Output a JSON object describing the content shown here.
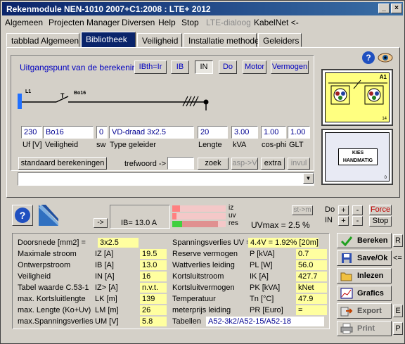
{
  "title": "Rekenmodule NEN-1010 2007+C1:2008 : LTE+ 2012",
  "menu": [
    "Algemeen",
    "Projecten Manager",
    "Diversen",
    "Help",
    "Stop",
    "LTE-dialoog",
    "KabelNet <-"
  ],
  "tabs": [
    "tabblad Algemeen",
    "Bibliotheek",
    "Veiligheid",
    "Installatie methode",
    "Geleiders"
  ],
  "basis": {
    "label": "Uitgangspunt van de berekening",
    "buttons": [
      "IBth=Ir",
      "IB",
      "IN",
      "Do",
      "Motor",
      "Vermogen"
    ]
  },
  "diagram": {
    "l1": "L1",
    "t": "T",
    "bo16": "Bo16"
  },
  "fields": {
    "uf": "230",
    "veiligheid": "Bo16",
    "sw": "0",
    "geleider": "VD-draad 3x2.5",
    "lengte": "20",
    "kva": "3.00",
    "cosphi": "1.00",
    "glt": "1.00"
  },
  "field_labels": [
    "Uf [V]",
    "Veiligheid",
    "sw",
    "Type geleider",
    "Lengte",
    "kVA",
    "cos-phi",
    "GLT"
  ],
  "search": {
    "standaard": "standaard berekeningen",
    "trefwoord": "trefwoord ->",
    "zoek": "zoek",
    "asp": "asp->V",
    "extra": "extra",
    "invul": "invul"
  },
  "thumb1": {
    "label": "A1",
    "corner": "14"
  },
  "thumb2": {
    "line1": "KIES",
    "line2": "HANDMATIG",
    "corner": "0"
  },
  "status": {
    "arrow": "->",
    "ib": "IB=  13.0 A",
    "legend_iz": "iz",
    "legend_uv": "uv",
    "legend_res": "res",
    "uvmax": "UVmax = 2.5 %",
    "stm": "st->m",
    "do": "Do",
    "in": "IN",
    "plus": "+",
    "minus": "-",
    "force": "Force",
    "stop": "Stop"
  },
  "results_left": [
    {
      "label": "Doorsnede [mm2] =",
      "sym": "",
      "val": "3x2.5"
    },
    {
      "label": "Maximale stroom",
      "sym": "IZ  [A]",
      "val": "19.5"
    },
    {
      "label": "Ontwerpstroom",
      "sym": "IB  [A]",
      "val": "13.0"
    },
    {
      "label": "Veiligheid",
      "sym": "IN  [A]",
      "val": "16"
    },
    {
      "label": "Tabel waarde C.53-1",
      "sym": "IZ> [A]",
      "val": "n.v.t."
    },
    {
      "label": "max. Kortsluitlengte",
      "sym": "LK  [m]",
      "val": "139"
    },
    {
      "label": "max. Lengte (Ko+Uv)",
      "sym": "LM  [m]",
      "val": "26"
    },
    {
      "label": "max.Spanningsverlies",
      "sym": "UM [V]",
      "val": "5.8"
    }
  ],
  "results_right": [
    {
      "label": "Spanningsverlies UV =",
      "sym": "",
      "val": "4.4V = 1.92% [20m]"
    },
    {
      "label": "Reserve vermogen",
      "sym": "P   [kVA]",
      "val": "0.7"
    },
    {
      "label": "Wattverlies leiding",
      "sym": "PL  [W]",
      "val": "56.0"
    },
    {
      "label": "Kortsluitstroom",
      "sym": "IK  [A]",
      "val": "427.7"
    },
    {
      "label": "Kortsluitvermogen",
      "sym": "PK  [kVA]",
      "val": "kNet"
    },
    {
      "label": "Temperatuur",
      "sym": "Tn  [°C]",
      "val": "47.9"
    },
    {
      "label": "meterprijs leiding",
      "sym": "PR [Euro]",
      "val": "="
    },
    {
      "label": "Tabellen",
      "sym": "",
      "val": "A52-3k2/A52-15/A52-18"
    }
  ],
  "side_buttons": [
    "Bereken",
    "Save/Ok",
    "Inlezen",
    "Grafics",
    "Export",
    "Print"
  ],
  "side_keys": {
    "r": "R",
    "arrow": "<=",
    "e": "E",
    "p": "P"
  },
  "levels": {
    "iz": 0.15,
    "uv": 0.08,
    "res": 0.85
  }
}
